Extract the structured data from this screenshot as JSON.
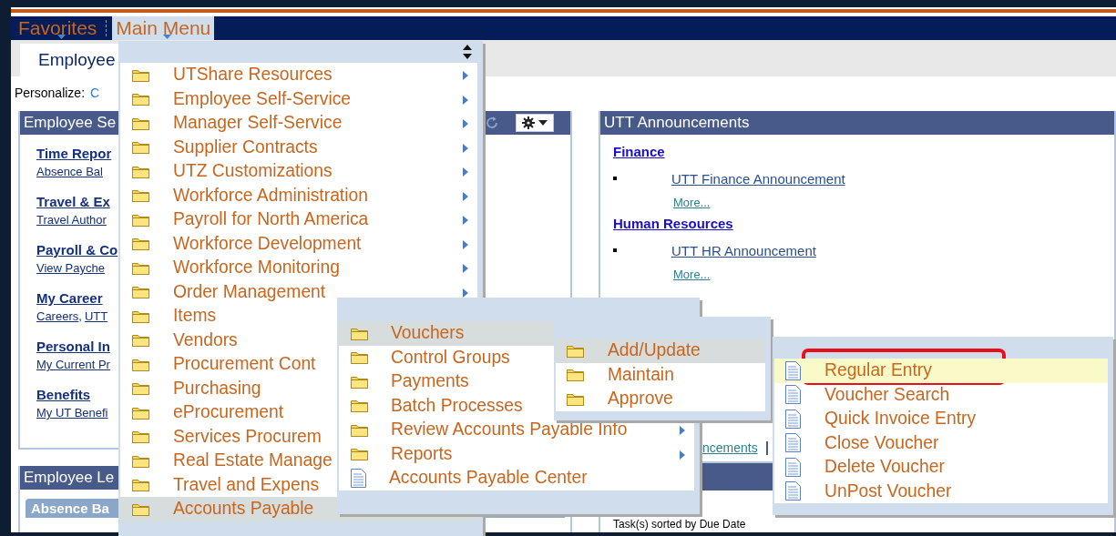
{
  "nav_bar": {
    "items": [
      {
        "label": "Favorites",
        "selected": false
      },
      {
        "label": "Main Menu",
        "selected": true
      }
    ]
  },
  "tabs": [
    {
      "label": "Employee",
      "selected": true
    }
  ],
  "personalize": {
    "label": "Personalize:",
    "link": "C"
  },
  "left_column": {
    "self_service": {
      "title": "Employee Se",
      "groups": [
        {
          "title": "Time Repor",
          "links": [
            "Absence Bal"
          ]
        },
        {
          "title": "Travel & Ex",
          "links": [
            "Travel Author"
          ]
        },
        {
          "title": "Payroll & Co",
          "links": [
            "View Payche"
          ]
        },
        {
          "title": "My Career",
          "links": [
            "Careers",
            "UTT"
          ],
          "separator": ","
        },
        {
          "title": "Personal In",
          "links": [
            "My Current Pr"
          ]
        },
        {
          "title": "Benefits",
          "links": [
            "My UT Benefi"
          ]
        }
      ]
    },
    "leave": {
      "title": "Employee Le",
      "subheader": "Absence Ba"
    }
  },
  "right_column": {
    "announcements": {
      "title": "UTT Announcements",
      "sections": [
        {
          "heading": "Finance",
          "items": [
            "UTT Finance Announcement"
          ],
          "more": "More..."
        },
        {
          "heading": "Human Resources",
          "items": [
            "UTT HR Announcement"
          ],
          "more": "More..."
        }
      ],
      "footer_link": "ncements",
      "footer_separator": "|"
    },
    "tasks": {
      "note": "Task(s) sorted by Due Date"
    }
  },
  "menus": [
    {
      "items": [
        {
          "label": "UTShare Resources",
          "kind": "folder",
          "submenu": true,
          "selected": false
        },
        {
          "label": "Employee Self-Service",
          "kind": "folder",
          "submenu": true,
          "selected": false
        },
        {
          "label": "Manager Self-Service",
          "kind": "folder",
          "submenu": true,
          "selected": false
        },
        {
          "label": "Supplier Contracts",
          "kind": "folder",
          "submenu": true,
          "selected": false
        },
        {
          "label": "UTZ Customizations",
          "kind": "folder",
          "submenu": true,
          "selected": false
        },
        {
          "label": "Workforce Administration",
          "kind": "folder",
          "submenu": true,
          "selected": false
        },
        {
          "label": "Payroll for North America",
          "kind": "folder",
          "submenu": true,
          "selected": false
        },
        {
          "label": "Workforce Development",
          "kind": "folder",
          "submenu": true,
          "selected": false
        },
        {
          "label": "Workforce Monitoring",
          "kind": "folder",
          "submenu": true,
          "selected": false
        },
        {
          "label": "Order Management",
          "kind": "folder",
          "submenu": true,
          "selected": false
        },
        {
          "label": "Items",
          "kind": "folder",
          "submenu": false,
          "selected": false
        },
        {
          "label": "Vendors",
          "kind": "folder",
          "submenu": false,
          "selected": false
        },
        {
          "label": "Procurement Cont",
          "kind": "folder",
          "submenu": false,
          "selected": false
        },
        {
          "label": "Purchasing",
          "kind": "folder",
          "submenu": false,
          "selected": false
        },
        {
          "label": "eProcurement",
          "kind": "folder",
          "submenu": false,
          "selected": false
        },
        {
          "label": "Services Procurem",
          "kind": "folder",
          "submenu": false,
          "selected": false
        },
        {
          "label": "Real Estate Manage",
          "kind": "folder",
          "submenu": false,
          "selected": false
        },
        {
          "label": "Travel and Expens",
          "kind": "folder",
          "submenu": false,
          "selected": false
        },
        {
          "label": "Accounts Payable",
          "kind": "folder",
          "submenu": false,
          "selected": true
        }
      ]
    },
    {
      "items": [
        {
          "label": "Vouchers",
          "kind": "folder",
          "submenu": false,
          "selected": true
        },
        {
          "label": "Control Groups",
          "kind": "folder",
          "submenu": false,
          "selected": false
        },
        {
          "label": "Payments",
          "kind": "folder",
          "submenu": false,
          "selected": false
        },
        {
          "label": "Batch Processes",
          "kind": "folder",
          "submenu": false,
          "selected": false
        },
        {
          "label": "Review Accounts Payable Info",
          "kind": "folder",
          "submenu": true,
          "selected": false
        },
        {
          "label": "Reports",
          "kind": "folder",
          "submenu": true,
          "selected": false
        },
        {
          "label": "Accounts Payable Center",
          "kind": "page",
          "submenu": false,
          "selected": false
        }
      ]
    },
    {
      "items": [
        {
          "label": "Add/Update",
          "kind": "folder",
          "selected": true
        },
        {
          "label": "Maintain",
          "kind": "folder",
          "selected": false
        },
        {
          "label": "Approve",
          "kind": "folder",
          "selected": false
        }
      ]
    },
    {
      "items": [
        {
          "label": "Regular Entry",
          "kind": "page",
          "selected": true,
          "annotated": true
        },
        {
          "label": "Voucher Search",
          "kind": "page",
          "selected": false,
          "annotated": false
        },
        {
          "label": "Quick Invoice Entry",
          "kind": "page",
          "selected": false,
          "annotated": false
        },
        {
          "label": "Close Voucher",
          "kind": "page",
          "selected": false,
          "annotated": false
        },
        {
          "label": "Delete Voucher",
          "kind": "page",
          "selected": false,
          "annotated": false
        },
        {
          "label": "UnPost Voucher",
          "kind": "page",
          "selected": false,
          "annotated": false
        }
      ]
    }
  ]
}
